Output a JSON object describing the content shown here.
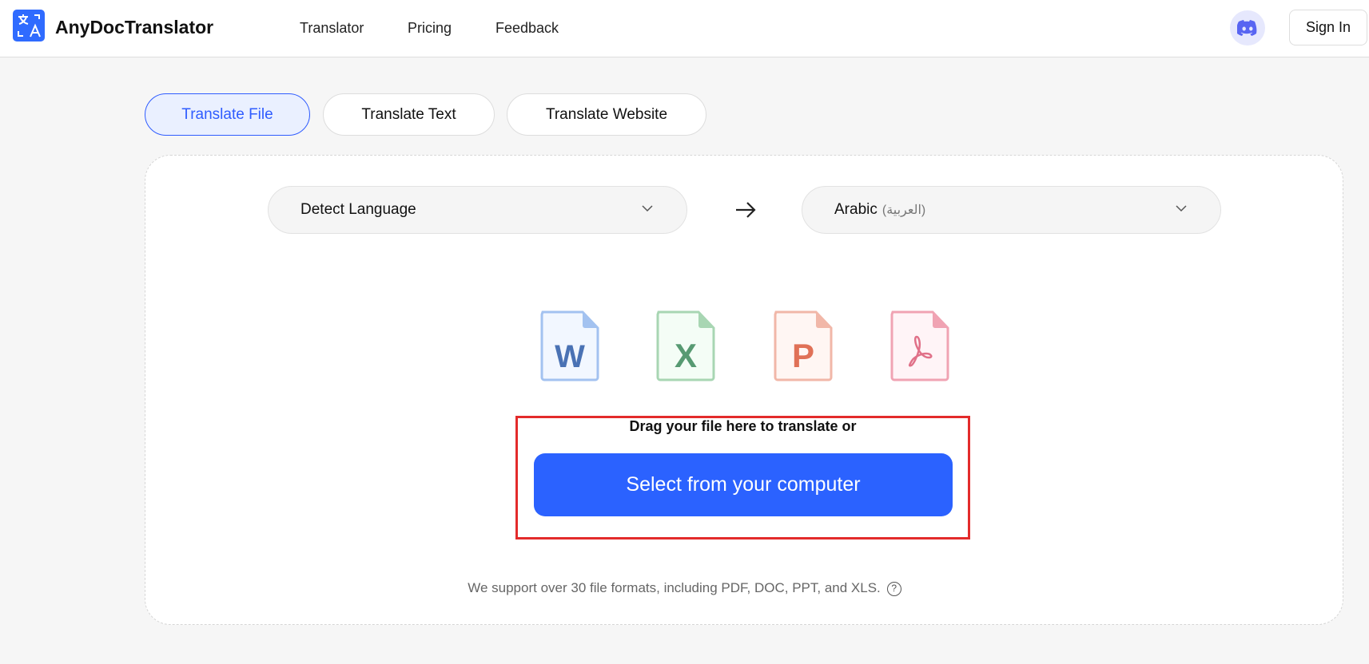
{
  "header": {
    "brand": "AnyDocTranslator",
    "nav": [
      "Translator",
      "Pricing",
      "Feedback"
    ],
    "sign_in": "Sign In"
  },
  "tabs": [
    {
      "label": "Translate File",
      "active": true
    },
    {
      "label": "Translate Text",
      "active": false
    },
    {
      "label": "Translate Website",
      "active": false
    }
  ],
  "languages": {
    "source": "Detect Language",
    "target": "Arabic",
    "target_native": "(العربية)"
  },
  "file_types": [
    "W",
    "X",
    "P",
    "PDF"
  ],
  "upload": {
    "drag_text": "Drag your file here to translate or",
    "button": "Select from your computer"
  },
  "support_text": "We support over 30 file formats, including PDF, DOC, PPT, and XLS.",
  "help_glyph": "?",
  "colors": {
    "accent": "#2b62ff",
    "highlight": "#e32b2b"
  }
}
